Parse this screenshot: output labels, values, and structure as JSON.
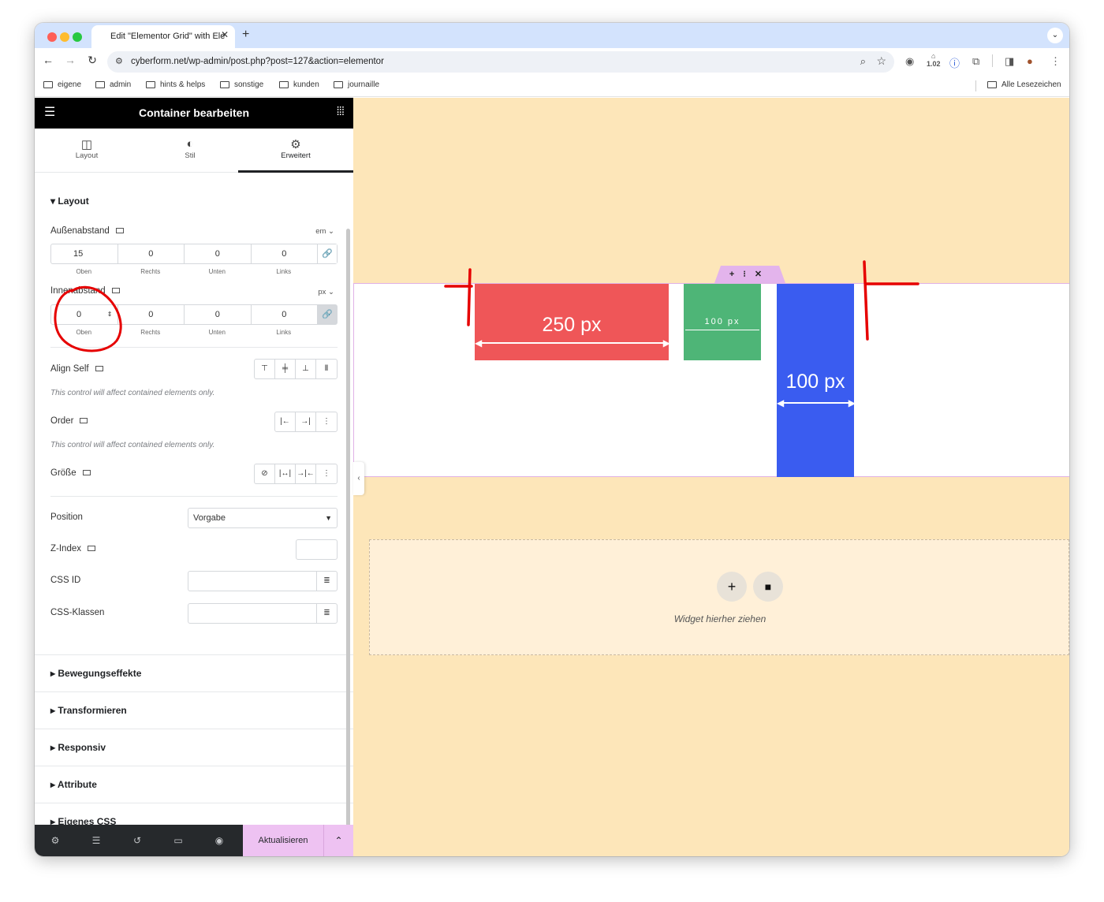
{
  "browser": {
    "tab_title": "Edit \"Elementor Grid\" with Ele",
    "url": "cyberform.net/wp-admin/post.php?post=127&action=elementor",
    "zoom_badge": "1.02",
    "bookmarks": [
      "eigene",
      "admin",
      "hints & helps",
      "sonstige",
      "kunden",
      "journaille"
    ],
    "all_bookmarks": "Alle Lesezeichen"
  },
  "panel": {
    "title": "Container bearbeiten",
    "tabs": [
      {
        "label": "Layout",
        "icon": "layout-icon"
      },
      {
        "label": "Stil",
        "icon": "half-circle-icon"
      },
      {
        "label": "Erweitert",
        "icon": "gear-icon"
      }
    ],
    "section_layout": "Layout",
    "margin": {
      "label": "Außenabstand",
      "unit": "em ⌄",
      "values": [
        "15",
        "0",
        "0",
        "0"
      ],
      "sides": [
        "Oben",
        "Rechts",
        "Unten",
        "Links"
      ]
    },
    "padding": {
      "label": "Innenabstand",
      "unit": "px ⌄",
      "values": [
        "0",
        "0",
        "0",
        "0"
      ],
      "sides": [
        "Oben",
        "Rechts",
        "Unten",
        "Links"
      ]
    },
    "align_self": "Align Self",
    "align_note": "This control will affect contained elements only.",
    "order": "Order",
    "order_note": "This control will affect contained elements only.",
    "size": "Größe",
    "position_label": "Position",
    "position_value": "Vorgabe",
    "zindex_label": "Z-Index",
    "cssid_label": "CSS ID",
    "cssclass_label": "CSS-Klassen",
    "accordions": [
      "Bewegungseffekte",
      "Transformieren",
      "Responsiv",
      "Attribute",
      "Eigenes CSS"
    ],
    "update_button": "Aktualisieren"
  },
  "canvas": {
    "blocks": [
      {
        "label": "250 px",
        "color": "#ef5658"
      },
      {
        "label": "100 px",
        "color": "#4eb577"
      },
      {
        "label": "100 px",
        "color": "#3a5cf0"
      }
    ],
    "dropzone_text": "Widget hierher ziehen",
    "background": "#fde6b9",
    "accent": "#eec2f2"
  }
}
